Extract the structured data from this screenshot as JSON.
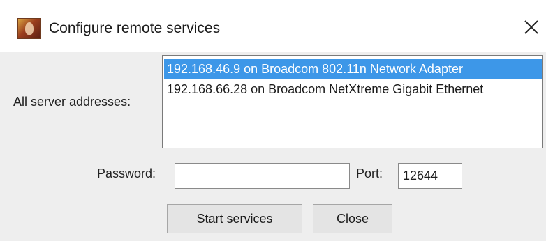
{
  "window": {
    "title": "Configure remote services",
    "close_glyph": "×",
    "app_icon": "app-icon"
  },
  "addresses": {
    "label": "All server addresses:",
    "items": [
      {
        "label": "192.168.46.9 on Broadcom 802.11n Network Adapter",
        "selected": true
      },
      {
        "label": "192.168.66.28 on Broadcom NetXtreme Gigabit Ethernet",
        "selected": false
      }
    ]
  },
  "password": {
    "label": "Password:",
    "value": ""
  },
  "port": {
    "label": "Port:",
    "value": "12644"
  },
  "buttons": {
    "start_label": "Start services",
    "close_label": "Close"
  },
  "colors": {
    "selection": "#3d97e8",
    "content_bg": "#eeeeee"
  }
}
